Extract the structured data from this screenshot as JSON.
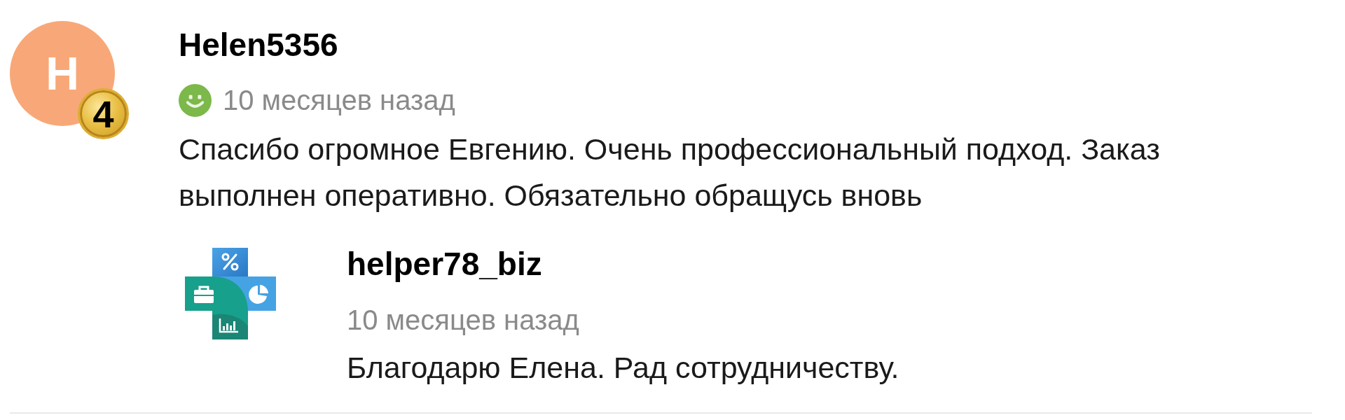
{
  "review": {
    "author": {
      "name": "Helen5356",
      "avatar_letter": "H",
      "rank": "4"
    },
    "time": "10 месяцев назад",
    "text": "Спасибо огромное Евгению. Очень профессиональный подход. Заказ выполнен оперативно. Обязательно обращусь вновь"
  },
  "reply": {
    "author": {
      "name": "helper78_biz"
    },
    "time": "10 месяцев назад",
    "text": "Благодарю Елена. Рад сотрудничеству."
  }
}
